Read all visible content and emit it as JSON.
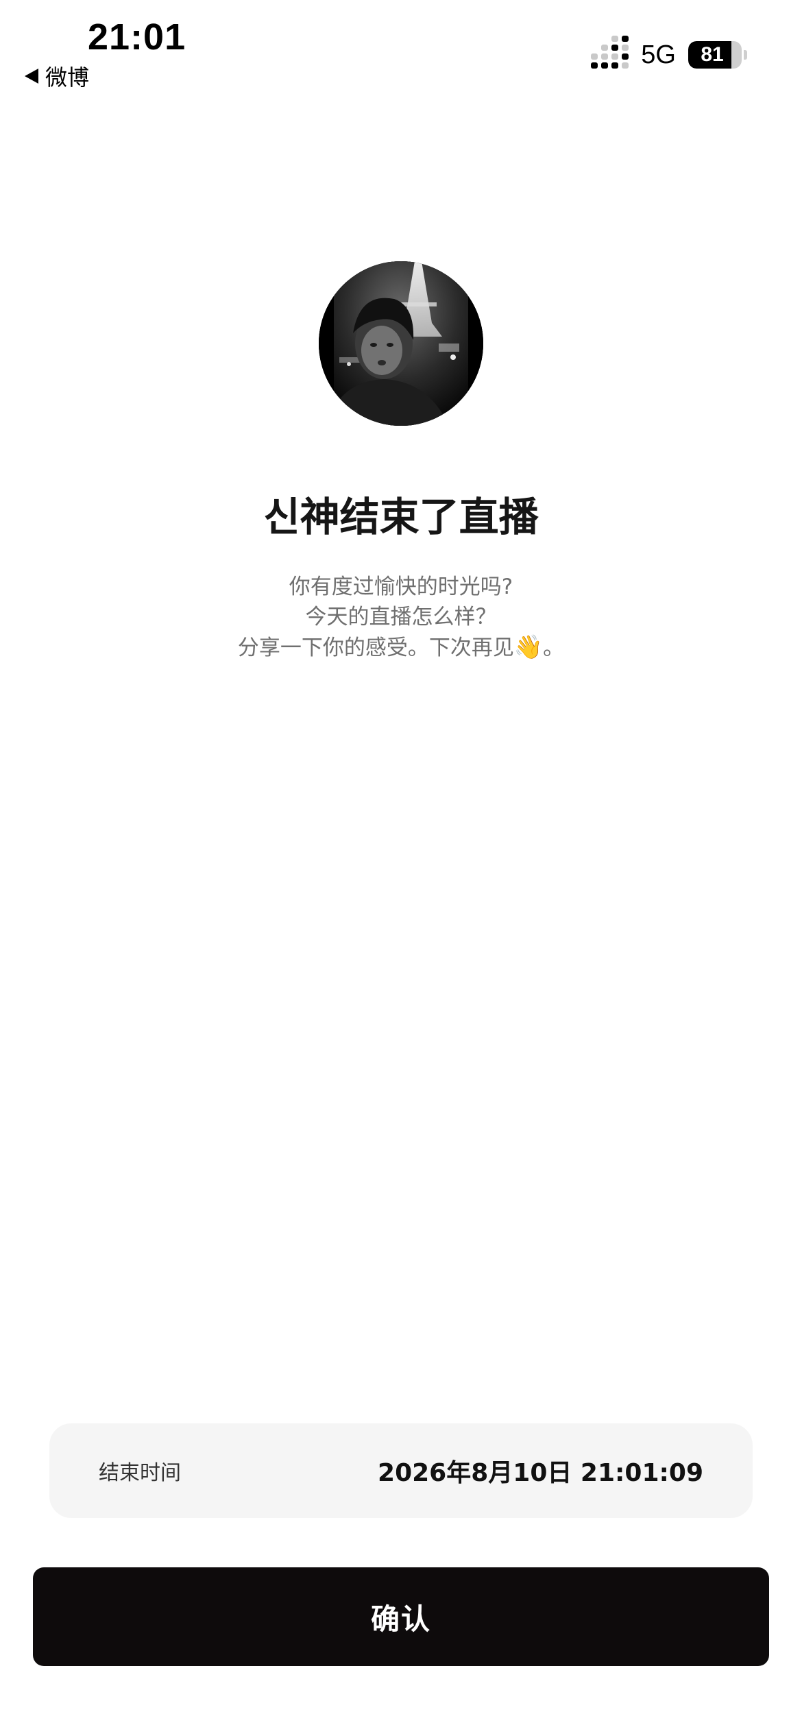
{
  "status_bar": {
    "time": "21:01",
    "back_app": "微博",
    "network": "5G",
    "battery_percent": "81",
    "battery_level": 0.81,
    "signal_bars_active": 4,
    "icons": [
      "back-arrow-icon",
      "signal-icon",
      "battery-icon"
    ]
  },
  "live_end": {
    "title": "신神结束了直播",
    "subtitle_lines": [
      "你有度过愉快的时光吗?",
      "今天的直播怎么样？"
    ],
    "subtitle_line3": "分享一下你的感受。下次再见",
    "subtitle_emoji": "👋",
    "subtitle_tail": "。"
  },
  "end_time": {
    "label": "结束时间",
    "value": "2026年8月10日 21:01:09"
  },
  "confirm_button": {
    "label": "确认"
  },
  "colors": {
    "button_bg": "#0e0b0c",
    "card_bg": "#f5f5f5",
    "subtitle": "#6f6f6f",
    "text": "#111111"
  }
}
